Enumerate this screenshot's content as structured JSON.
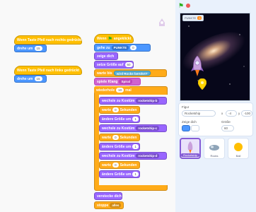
{
  "scripts": {
    "a_hat": "Wenn Taste  Pfeil nach rechts  gedrückt",
    "a_move": "drehe um",
    "a_move_val": "15",
    "b_hat": "Wenn Taste  Pfeil nach links  gedrückt",
    "b_move": "drehe um",
    "b_move_val": "15",
    "main_hat": "Wenn",
    "main_hat2": "angeklickt",
    "goto": "gehe zu",
    "goto_x_label": "PUNKTE",
    "goto_y": "0",
    "show": "zeige dich",
    "size": "setze Größe auf",
    "size_val": "60",
    "wait_until": "warte bis",
    "touching": "wird",
    "touching_target": "Rocks",
    "touching_end": "berührt?",
    "play_sound": "spiele Klang",
    "sound_name": "Spiral",
    "repeat": "wiederhole",
    "repeat_val": "10",
    "repeat_end": "mal",
    "costume1": "wechsle zu Kostüm",
    "costume1_val": "rocketship-b",
    "wait1": "warte",
    "wait1_val": "0",
    "wait1_end": "Sekunden",
    "size_change1": "ändere Größe um",
    "size_change1_val": "1",
    "costume2": "wechsle zu Kostüm",
    "costume2_val": "rocketship-c",
    "wait2": "warte",
    "wait2_val": "0",
    "wait2_end": "Sekunden",
    "size_change2": "ändere Größe um",
    "size_change2_val": "1",
    "costume3": "wechsle zu Kostüm",
    "costume3_val": "rocketship-d",
    "wait3": "warte",
    "wait3_val": "0",
    "wait3_end": "Sekunden",
    "size_change3": "ändere Größe um",
    "size_change3_val": "1",
    "hide": "verstecke dich",
    "stop": "stoppe",
    "stop_val": "alles"
  },
  "stage": {
    "points_label": "PUNKTE",
    "points_value": "0"
  },
  "sprite_info": {
    "sprite_label": "Figur",
    "sprite_name": "Rocketship",
    "x_label": "x",
    "x_value": "-4",
    "y_label": "y",
    "y_value": "-100",
    "show_label": "Zeige dich",
    "size_label": "Größe",
    "size_value": "60"
  },
  "sprites": [
    {
      "name": "Rocketship"
    },
    {
      "name": "Rocks"
    },
    {
      "name": "Ball"
    }
  ],
  "colors": {
    "events": "#ffbf00",
    "motion": "#4c97ff",
    "looks": "#9966ff",
    "sound": "#cf63cf",
    "control": "#ffab19",
    "selected": "#855cd6"
  }
}
